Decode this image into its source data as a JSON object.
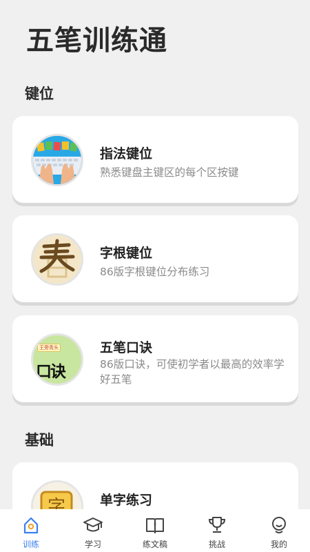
{
  "app": {
    "title": "五笔训练通"
  },
  "sections": [
    {
      "title": "键位",
      "cards": [
        {
          "title": "指法键位",
          "desc": "熟悉键盘主键区的每个区按键",
          "icon": "keyboard-hands-icon"
        },
        {
          "title": "字根键位",
          "desc": "86版字根键位分布练习",
          "icon": "radical-character-icon"
        },
        {
          "title": "五笔口诀",
          "desc": "86版口诀，可使初学者以最高的效率学好五笔",
          "icon": "mnemonic-icon",
          "thumb_caption": "王旁青头",
          "thumb_text": "口诀"
        }
      ]
    },
    {
      "title": "基础",
      "cards": [
        {
          "title": "单字练习",
          "icon": "single-char-icon"
        }
      ]
    }
  ],
  "tabbar": {
    "active": "训练",
    "items": [
      {
        "label": "训练",
        "icon": "home-icon"
      },
      {
        "label": "学习",
        "icon": "graduation-cap-icon"
      },
      {
        "label": "练文稿",
        "icon": "book-icon"
      },
      {
        "label": "挑战",
        "icon": "trophy-icon"
      },
      {
        "label": "我的",
        "icon": "face-icon"
      }
    ]
  },
  "colors": {
    "accent": "#3b7ff0",
    "background": "#f0f0f0",
    "card": "#ffffff"
  }
}
